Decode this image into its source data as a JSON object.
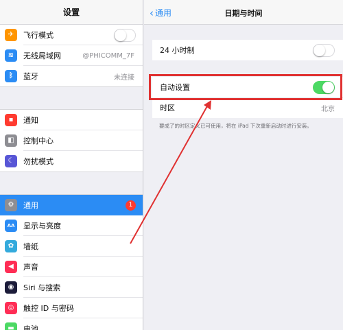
{
  "sidebar": {
    "title": "设置",
    "group1": [
      {
        "label": "飞行模式",
        "icon": "airplane-icon",
        "color": "#ff9500",
        "glyph": "✈",
        "control": "toggle",
        "on": false
      },
      {
        "label": "无线局域网",
        "icon": "wifi-icon",
        "color": "#2b8cf4",
        "glyph": "≋",
        "value": "@PHICOMM_7F"
      },
      {
        "label": "蓝牙",
        "icon": "bluetooth-icon",
        "color": "#2b8cf4",
        "glyph": "ᛒ",
        "value": "未连接"
      }
    ],
    "group2": [
      {
        "label": "通知",
        "icon": "notifications-icon",
        "color": "#ff3b30",
        "glyph": "▪"
      },
      {
        "label": "控制中心",
        "icon": "control-center-icon",
        "color": "#8e8e93",
        "glyph": "◧"
      },
      {
        "label": "勿扰模式",
        "icon": "moon-icon",
        "color": "#5856d6",
        "glyph": "☾"
      }
    ],
    "group3": [
      {
        "label": "通用",
        "icon": "gear-icon",
        "color": "#8e8e93",
        "glyph": "⚙",
        "badge": "1",
        "selected": true
      },
      {
        "label": "显示与亮度",
        "icon": "display-icon",
        "color": "#2b8cf4",
        "glyph": "AA"
      },
      {
        "label": "墙纸",
        "icon": "wallpaper-icon",
        "color": "#34aadc",
        "glyph": "✿"
      },
      {
        "label": "声音",
        "icon": "sound-icon",
        "color": "#ff2d55",
        "glyph": "◀"
      },
      {
        "label": "Siri 与搜索",
        "icon": "siri-icon",
        "color": "#1c1c3a",
        "glyph": "◉"
      },
      {
        "label": "触控 ID 与密码",
        "icon": "fingerprint-icon",
        "color": "#ff2d55",
        "glyph": "◎"
      },
      {
        "label": "电池",
        "icon": "battery-icon",
        "color": "#4cd964",
        "glyph": "▬"
      }
    ]
  },
  "detail": {
    "back_label": "通用",
    "title": "日期与时间",
    "row_24h": {
      "label": "24 小时制",
      "on": false
    },
    "row_auto": {
      "label": "自动设置",
      "on": true
    },
    "row_tz": {
      "label": "时区",
      "value": "北京"
    },
    "footnote": "要成了的时区定义已可使用，将在 iPad 下次重新启动时进行安装。"
  },
  "colors": {
    "accent": "#2b8cf4",
    "toggle_on": "#4cd964",
    "annotation": "#e03131"
  }
}
